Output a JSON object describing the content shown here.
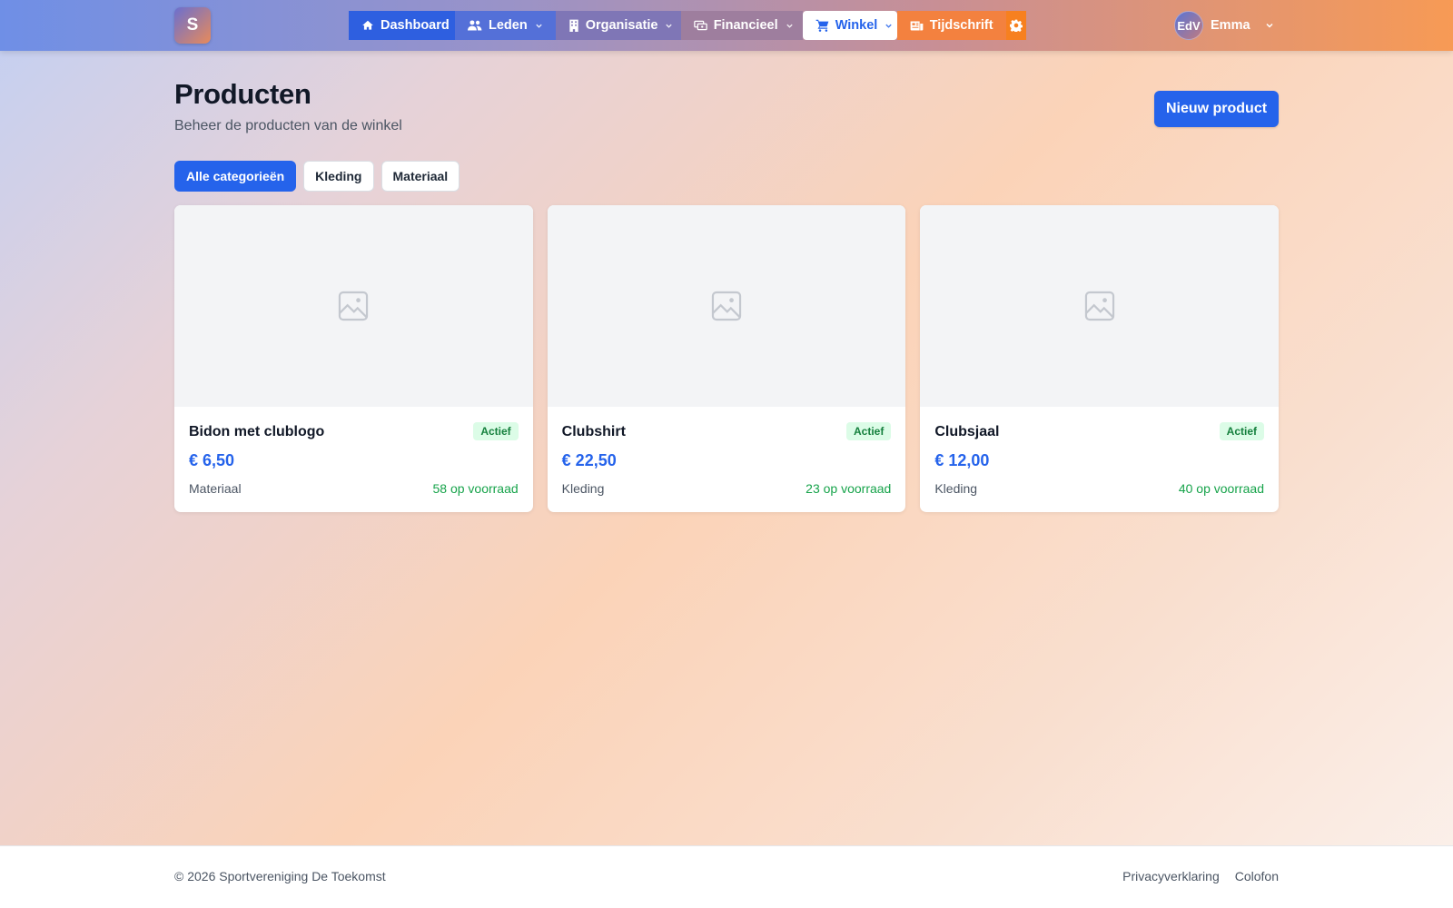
{
  "app": {
    "logo_letter": "S"
  },
  "nav": {
    "items": [
      {
        "label": "Dashboard",
        "icon": "home-icon"
      },
      {
        "label": "Leden",
        "icon": "users-icon"
      },
      {
        "label": "Organisatie",
        "icon": "building-icon"
      },
      {
        "label": "Financieel",
        "icon": "money-icon"
      },
      {
        "label": "Winkel",
        "icon": "cart-icon",
        "active": true
      },
      {
        "label": "Tijdschrift",
        "icon": "newspaper-icon"
      }
    ],
    "settings_icon": "gear-icon"
  },
  "user": {
    "initials": "EdV",
    "name": "Emma"
  },
  "page": {
    "title": "Producten",
    "subtitle": "Beheer de producten van de winkel",
    "new_button": "Nieuw product"
  },
  "filters": [
    {
      "label": "Alle categorieën",
      "active": true
    },
    {
      "label": "Kleding",
      "active": false
    },
    {
      "label": "Materiaal",
      "active": false
    }
  ],
  "products": [
    {
      "name": "Bidon met clublogo",
      "status": "Actief",
      "price": "€ 6,50",
      "category": "Materiaal",
      "stock": "58 op voorraad",
      "image_icon": "image-placeholder-icon"
    },
    {
      "name": "Clubshirt",
      "status": "Actief",
      "price": "€ 22,50",
      "category": "Kleding",
      "stock": "23 op voorraad",
      "image_icon": "image-placeholder-icon"
    },
    {
      "name": "Clubsjaal",
      "status": "Actief",
      "price": "€ 12,00",
      "category": "Kleding",
      "stock": "40 op voorraad",
      "image_icon": "image-placeholder-icon"
    }
  ],
  "footer": {
    "copyright": "© 2026 Sportvereniging De Toekomst",
    "links": [
      "Privacyverklaring",
      "Colofon"
    ]
  },
  "colors": {
    "accent": "#2563eb",
    "status_active_bg": "#dcfce7",
    "status_active_text": "#15803d",
    "stock_text": "#16a34a"
  }
}
